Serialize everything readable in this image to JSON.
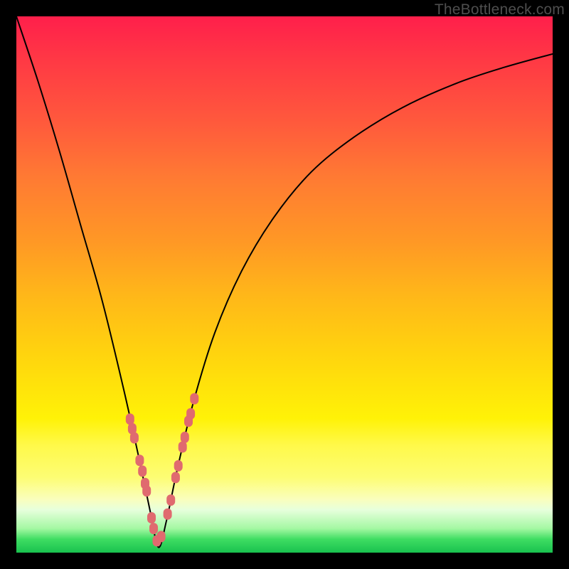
{
  "watermark": "TheBottleneck.com",
  "colors": {
    "frame": "#000000",
    "curve": "#000000",
    "marker": "#e06a6f",
    "gradient_top": "#ff1f4b",
    "gradient_bottom": "#19c24f"
  },
  "chart_data": {
    "type": "line",
    "title": "",
    "xlabel": "",
    "ylabel": "",
    "xlim": [
      0,
      1
    ],
    "ylim": [
      0,
      1
    ],
    "x_at_min": 0.265,
    "series": [
      {
        "name": "bottleneck-curve",
        "x": [
          0.0,
          0.04,
          0.08,
          0.12,
          0.16,
          0.2,
          0.23,
          0.25,
          0.265,
          0.28,
          0.3,
          0.33,
          0.37,
          0.42,
          0.48,
          0.55,
          0.63,
          0.72,
          0.82,
          0.91,
          1.0
        ],
        "y": [
          1.0,
          0.88,
          0.75,
          0.61,
          0.47,
          0.305,
          0.17,
          0.075,
          0.01,
          0.06,
          0.155,
          0.28,
          0.41,
          0.525,
          0.625,
          0.71,
          0.775,
          0.83,
          0.875,
          0.905,
          0.93
        ]
      }
    ],
    "markers": {
      "name": "highlighted-points",
      "x": [
        0.212,
        0.216,
        0.22,
        0.23,
        0.235,
        0.24,
        0.243,
        0.252,
        0.256,
        0.262,
        0.27,
        0.282,
        0.288,
        0.297,
        0.302,
        0.31,
        0.314,
        0.321,
        0.325,
        0.332
      ],
      "y": [
        0.249,
        0.231,
        0.214,
        0.172,
        0.152,
        0.129,
        0.115,
        0.065,
        0.045,
        0.022,
        0.03,
        0.072,
        0.098,
        0.14,
        0.162,
        0.197,
        0.215,
        0.245,
        0.259,
        0.287
      ]
    }
  }
}
